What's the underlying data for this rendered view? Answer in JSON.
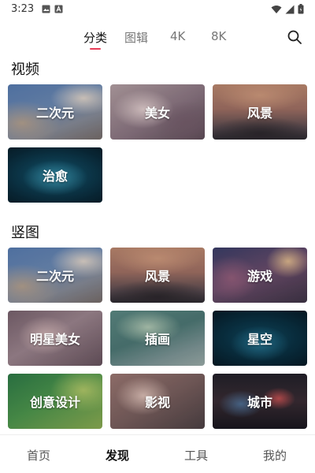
{
  "status": {
    "time": "3:23",
    "left_icons": [
      "image-icon",
      "a-icon"
    ],
    "right_icons": [
      "wifi-icon",
      "signal-icon",
      "battery-icon"
    ]
  },
  "top_tabs": {
    "items": [
      {
        "label": "分类",
        "active": true
      },
      {
        "label": "图辑",
        "active": false
      },
      {
        "label": "4K",
        "active": false
      },
      {
        "label": "8K",
        "active": false
      }
    ],
    "accent": "#e83b57",
    "search_icon": "search-icon"
  },
  "sections": [
    {
      "title": "视频",
      "tiles": [
        "二次元",
        "美女",
        "风景",
        "治愈"
      ]
    },
    {
      "title": "竖图",
      "tiles": [
        "二次元",
        "风景",
        "游戏",
        "明星美女",
        "插画",
        "星空",
        "创意设计",
        "影视",
        "城市"
      ]
    }
  ],
  "bottom_nav": {
    "items": [
      {
        "label": "首页",
        "active": false
      },
      {
        "label": "发现",
        "active": true
      },
      {
        "label": "工具",
        "active": false
      },
      {
        "label": "我的",
        "active": false
      }
    ]
  }
}
